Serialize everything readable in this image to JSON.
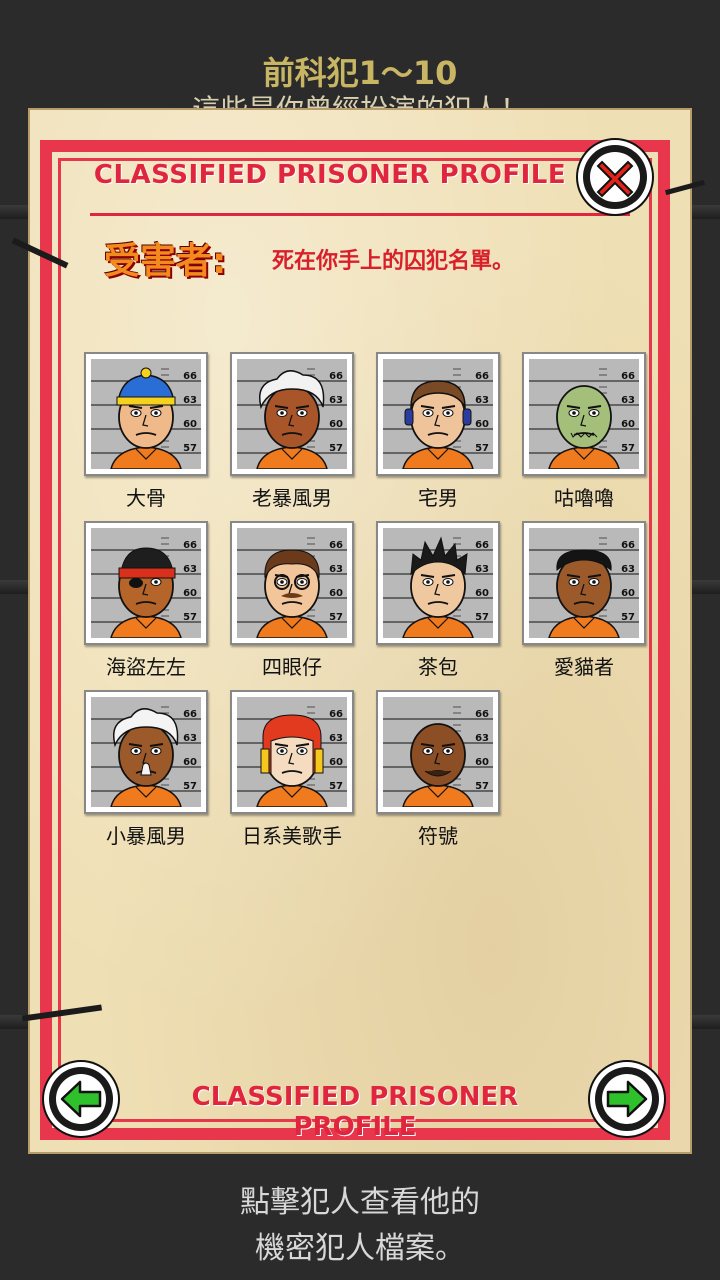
{
  "header": {
    "title": "前科犯1～10",
    "subtitle": "這些是你曾經扮演的犯人！"
  },
  "panel": {
    "top_title": "CLASSIFIED PRISONER PROFILE",
    "bottom_title": "CLASSIFIED PRISONER PROFILE",
    "victim_label": "受害者:",
    "victim_desc": "死在你手上的囚犯名單。"
  },
  "ruler_ticks": [
    "66",
    "63",
    "60",
    "57"
  ],
  "prisoners": [
    {
      "name": "大骨",
      "skin": "#f0b98a",
      "hair": "#2a6dd4",
      "hair_style": "beanie"
    },
    {
      "name": "老暴風男",
      "skin": "#a9552a",
      "hair": "#f2f2f2",
      "hair_style": "white-poof"
    },
    {
      "name": "宅男",
      "skin": "#f0c49a",
      "hair": "#7a4a26",
      "hair_style": "headphones"
    },
    {
      "name": "咕嚕嚕",
      "skin": "#a4bf7a",
      "hair": "#8aa566",
      "hair_style": "bald"
    },
    {
      "name": "海盜左左",
      "skin": "#b6652a",
      "hair": "#1e1e1e",
      "hair_style": "bandana"
    },
    {
      "name": "四眼仔",
      "skin": "#f2c59b",
      "hair": "#6a3a1a",
      "hair_style": "glasses"
    },
    {
      "name": "茶包",
      "skin": "#f0c8a0",
      "hair": "#1a1a1a",
      "hair_style": "spiky"
    },
    {
      "name": "愛貓者",
      "skin": "#9c5a2a",
      "hair": "#141414",
      "hair_style": "curly"
    },
    {
      "name": "小暴風男",
      "skin": "#9c5a2a",
      "hair": "#f4f4f4",
      "hair_style": "white-wild"
    },
    {
      "name": "日系美歌手",
      "skin": "#f5dcc0",
      "hair": "#e23a1e",
      "hair_style": "japanese"
    },
    {
      "name": "符號",
      "skin": "#8c4e24",
      "hair": "#8c4e24",
      "hair_style": "bald-dark"
    }
  ],
  "footer": {
    "line1": "點擊犯人查看他的",
    "line2": "機密犯人檔案。"
  },
  "colors": {
    "frame_red": "#e8374d",
    "paper": "#efdfb4",
    "jumpsuit": "#f07a1e",
    "arrow_green": "#2fc12c"
  }
}
